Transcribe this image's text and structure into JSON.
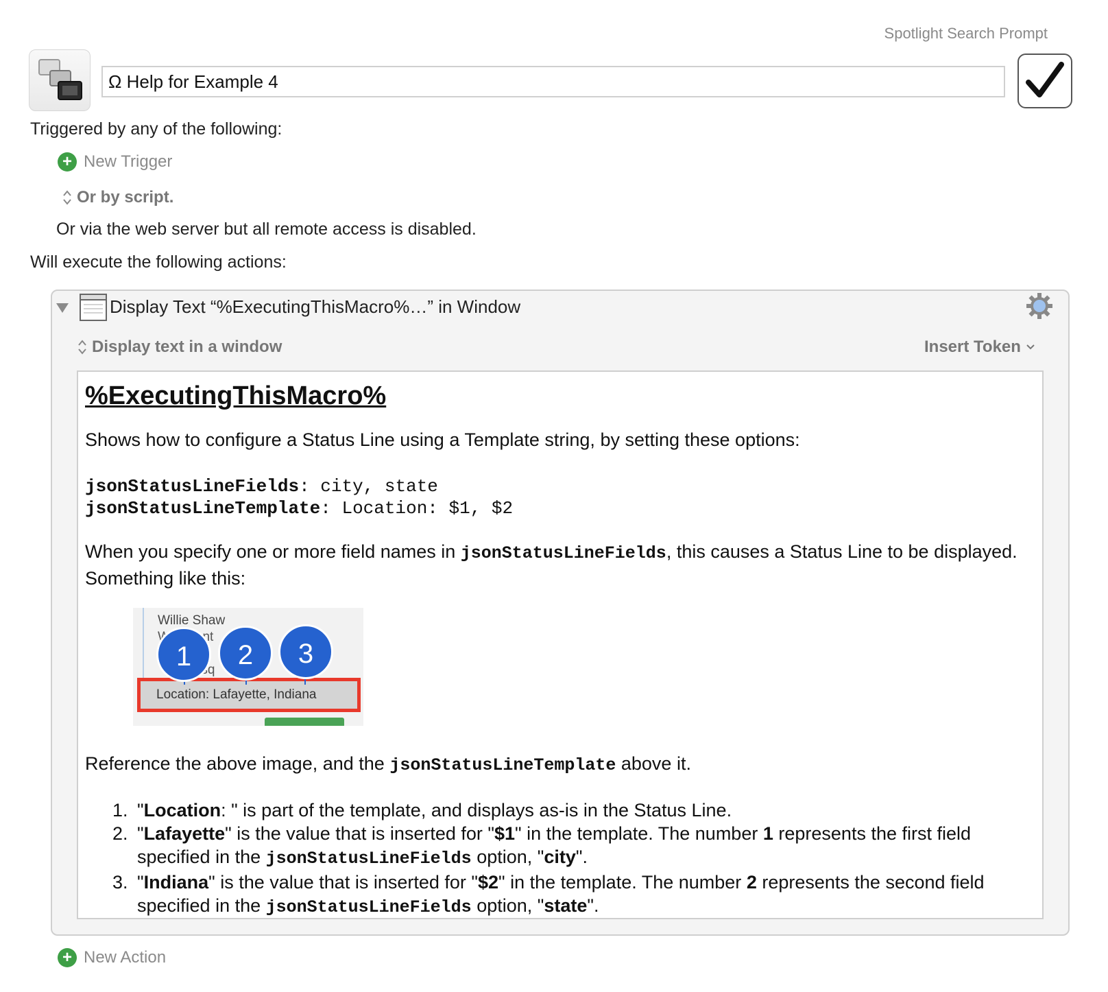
{
  "header": {
    "spotlight_label": "Spotlight Search Prompt",
    "macro_name": "Ω Help for Example 4"
  },
  "triggers": {
    "heading": "Triggered by any of the following:",
    "new_trigger": "New Trigger",
    "or_by_script": "Or by script.",
    "web_server_note": "Or via the web server but all remote access is disabled."
  },
  "actions": {
    "heading": "Will execute the following actions:",
    "action_title": "Display Text “%ExecutingThisMacro%…” in Window",
    "mode_label": "Display text in a window",
    "insert_token": "Insert Token",
    "new_action": "New Action"
  },
  "document": {
    "title": "%ExecutingThisMacro%",
    "intro": "Shows how to configure a Status Line using a Template string, by setting these options:",
    "opt1_key": "jsonStatusLineFields",
    "opt1_value": ": city, state",
    "opt2_key": "jsonStatusLineTemplate",
    "opt2_value": ": Location: $1, $2",
    "para2_a": "When you specify one or more field names in ",
    "para2_code": "jsonStatusLineFields",
    "para2_b": ", this causes a Status Line to be displayed. Something like this:",
    "figure": {
      "name_line": "Willie Shaw",
      "line2": "W    Mont        y",
      "line3": "         we",
      "line4": "          asq",
      "status_line": "Location: Lafayette, Indiana",
      "pins": [
        "1",
        "2",
        "3"
      ]
    },
    "para3_a": "Reference the above image, and the ",
    "para3_code": "jsonStatusLineTemplate",
    "para3_b": " above it.",
    "items": [
      {
        "q1": "\"",
        "b1": "Location",
        "t1": ": \" is part of the template, and displays as-is in the Status Line."
      },
      {
        "q1": "\"",
        "b1": "Lafayette",
        "t1": "\" is the value that is inserted for \"",
        "b2": "$1",
        "t2": "\" in the template. The number ",
        "b3": "1",
        "t3": " represents the first field specified in the ",
        "code": "jsonStatusLineFields",
        "t4": " option, \"",
        "b4": "city",
        "t5": "\"."
      },
      {
        "q1": "\"",
        "b1": "Indiana",
        "t1": "\" is the value that is inserted for \"",
        "b2": "$2",
        "t2": "\" in the template. The number ",
        "b3": "2",
        "t3": " represents the second field specified in the ",
        "code": "jsonStatusLineFields",
        "t4": " option, \"",
        "b4": "state",
        "t5": "\"."
      }
    ]
  }
}
